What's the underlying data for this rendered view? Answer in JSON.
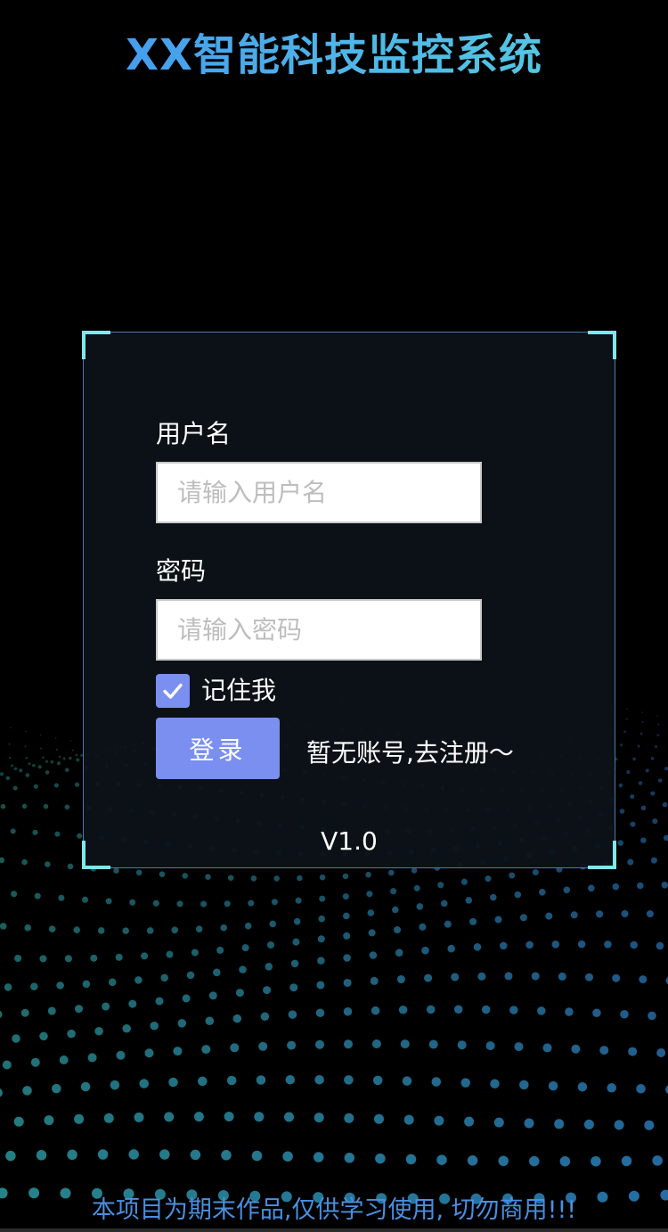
{
  "header": {
    "title": "XX智能科技监控系统"
  },
  "login_form": {
    "username_label": "用户名",
    "username_placeholder": "请输入用户名",
    "username_value": "",
    "password_label": "密码",
    "password_placeholder": "请输入密码",
    "password_value": "",
    "remember_label": "记住我",
    "remember_checked": true,
    "login_button_label": "登录",
    "register_link_label": "暂无账号,去注册～",
    "version": "V1.0"
  },
  "footer": {
    "note": "本项目为期末作品,仅供学习使用, 切勿商用!!!"
  },
  "icons": {
    "checkbox": "checkmark-icon"
  },
  "colors": {
    "background": "#000000",
    "title_gradient_start": "#3f8ff0",
    "title_gradient_end": "#56d2e0",
    "panel_border": "#4f78b8",
    "panel_corner": "#7fe8ec",
    "accent": "#7b8ff0",
    "footer_text": "#4a8fe0"
  }
}
